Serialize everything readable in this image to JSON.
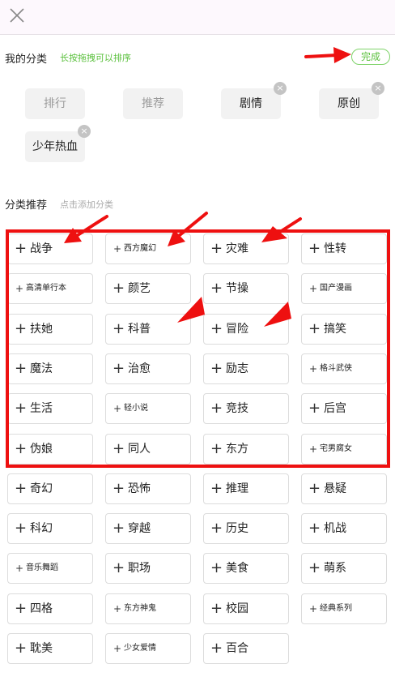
{
  "header": {
    "close_icon": "close-x-icon"
  },
  "my_categories": {
    "title": "我的分类",
    "hint": "长按拖拽可以排序",
    "done_label": "完成",
    "accent_color": "#5cc13f",
    "chips": [
      {
        "label": "排行",
        "removable": false
      },
      {
        "label": "推荐",
        "removable": false
      },
      {
        "label": "剧情",
        "removable": true
      },
      {
        "label": "原创",
        "removable": true
      },
      {
        "label": "少年热血",
        "removable": true
      }
    ]
  },
  "recommended": {
    "title": "分类推荐",
    "hint": "点击添加分类",
    "tiles": [
      {
        "label": "战争",
        "small": false
      },
      {
        "label": "西方魔幻",
        "small": true
      },
      {
        "label": "灾难",
        "small": false
      },
      {
        "label": "性转",
        "small": false
      },
      {
        "label": "高清单行本",
        "small": true
      },
      {
        "label": "颜艺",
        "small": false
      },
      {
        "label": "节操",
        "small": false
      },
      {
        "label": "国产漫画",
        "small": true
      },
      {
        "label": "扶她",
        "small": false
      },
      {
        "label": "科普",
        "small": false
      },
      {
        "label": "冒险",
        "small": false
      },
      {
        "label": "搞笑",
        "small": false
      },
      {
        "label": "魔法",
        "small": false
      },
      {
        "label": "治愈",
        "small": false
      },
      {
        "label": "励志",
        "small": false
      },
      {
        "label": "格斗武侠",
        "small": true
      },
      {
        "label": "生活",
        "small": false
      },
      {
        "label": "轻小说",
        "small": true
      },
      {
        "label": "竞技",
        "small": false
      },
      {
        "label": "后宫",
        "small": false
      },
      {
        "label": "伪娘",
        "small": false
      },
      {
        "label": "同人",
        "small": false
      },
      {
        "label": "东方",
        "small": false
      },
      {
        "label": "宅男腐女",
        "small": true
      },
      {
        "label": "奇幻",
        "small": false
      },
      {
        "label": "恐怖",
        "small": false
      },
      {
        "label": "推理",
        "small": false
      },
      {
        "label": "悬疑",
        "small": false
      },
      {
        "label": "科幻",
        "small": false
      },
      {
        "label": "穿越",
        "small": false
      },
      {
        "label": "历史",
        "small": false
      },
      {
        "label": "机战",
        "small": false
      },
      {
        "label": "音乐舞蹈",
        "small": true
      },
      {
        "label": "职场",
        "small": false
      },
      {
        "label": "美食",
        "small": false
      },
      {
        "label": "萌系",
        "small": false
      },
      {
        "label": "四格",
        "small": false
      },
      {
        "label": "东方神鬼",
        "small": true
      },
      {
        "label": "校园",
        "small": false
      },
      {
        "label": "经典系列",
        "small": true
      },
      {
        "label": "耽美",
        "small": false
      },
      {
        "label": "少女爱情",
        "small": true
      },
      {
        "label": "百合",
        "small": false
      }
    ]
  },
  "annotation": {
    "color": "#ee1010"
  }
}
